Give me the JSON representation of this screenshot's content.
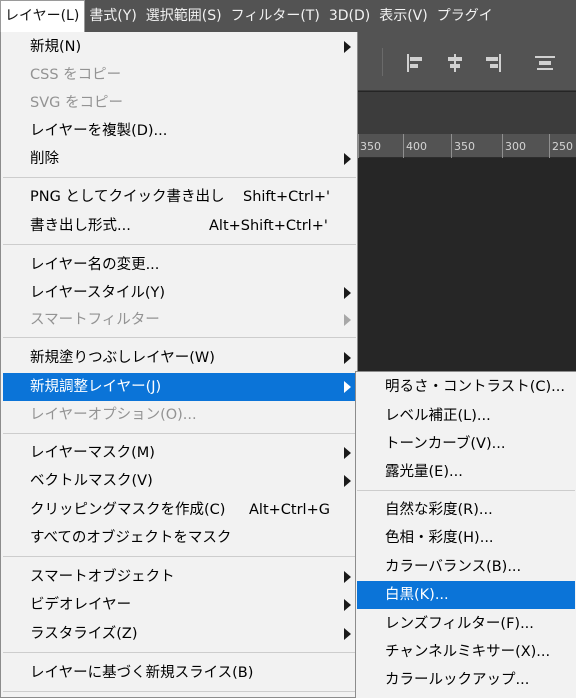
{
  "menubar": {
    "items": [
      {
        "label": "レイヤー(L)"
      },
      {
        "label": "書式(Y)"
      },
      {
        "label": "選択範囲(S)"
      },
      {
        "label": "フィルター(T)"
      },
      {
        "label": "3D(D)"
      },
      {
        "label": "表示(V)"
      },
      {
        "label": "プラグイ"
      }
    ]
  },
  "ruler": {
    "labels": [
      "350",
      "400",
      "350",
      "300",
      "250"
    ]
  },
  "layer_menu": {
    "items": [
      {
        "label": "新規(N)",
        "shortcut": "",
        "submenu": true,
        "disabled": false
      },
      {
        "label": "CSS をコピー",
        "shortcut": "",
        "submenu": false,
        "disabled": true
      },
      {
        "label": "SVG をコピー",
        "shortcut": "",
        "submenu": false,
        "disabled": true
      },
      {
        "label": "レイヤーを複製(D)...",
        "shortcut": "",
        "submenu": false,
        "disabled": false
      },
      {
        "label": "削除",
        "shortcut": "",
        "submenu": true,
        "disabled": false
      },
      {
        "label": "PNG としてクイック書き出し",
        "shortcut": "Shift+Ctrl+'",
        "submenu": false,
        "disabled": false
      },
      {
        "label": "書き出し形式...",
        "shortcut": "Alt+Shift+Ctrl+'",
        "submenu": false,
        "disabled": false
      },
      {
        "label": "レイヤー名の変更...",
        "shortcut": "",
        "submenu": false,
        "disabled": false
      },
      {
        "label": "レイヤースタイル(Y)",
        "shortcut": "",
        "submenu": true,
        "disabled": false
      },
      {
        "label": "スマートフィルター",
        "shortcut": "",
        "submenu": true,
        "disabled": true
      },
      {
        "label": "新規塗りつぶしレイヤー(W)",
        "shortcut": "",
        "submenu": true,
        "disabled": false
      },
      {
        "label": "新規調整レイヤー(J)",
        "shortcut": "",
        "submenu": true,
        "disabled": false,
        "highlighted": true
      },
      {
        "label": "レイヤーオプション(O)...",
        "shortcut": "",
        "submenu": false,
        "disabled": true
      },
      {
        "label": "レイヤーマスク(M)",
        "shortcut": "",
        "submenu": true,
        "disabled": false
      },
      {
        "label": "ベクトルマスク(V)",
        "shortcut": "",
        "submenu": true,
        "disabled": false
      },
      {
        "label": "クリッピングマスクを作成(C)",
        "shortcut": "Alt+Ctrl+G",
        "submenu": false,
        "disabled": false
      },
      {
        "label": "すべてのオブジェクトをマスク",
        "shortcut": "",
        "submenu": false,
        "disabled": false
      },
      {
        "label": "スマートオブジェクト",
        "shortcut": "",
        "submenu": true,
        "disabled": false
      },
      {
        "label": "ビデオレイヤー",
        "shortcut": "",
        "submenu": true,
        "disabled": false
      },
      {
        "label": "ラスタライズ(Z)",
        "shortcut": "",
        "submenu": true,
        "disabled": false
      },
      {
        "label": "レイヤーに基づく新規スライス(B)",
        "shortcut": "",
        "submenu": false,
        "disabled": false
      }
    ]
  },
  "adjustment_submenu": {
    "items": [
      {
        "label": "明るさ・コントラスト(C)..."
      },
      {
        "label": "レベル補正(L)..."
      },
      {
        "label": "トーンカーブ(V)..."
      },
      {
        "label": "露光量(E)..."
      },
      {
        "label": "自然な彩度(R)..."
      },
      {
        "label": "色相・彩度(H)..."
      },
      {
        "label": "カラーバランス(B)..."
      },
      {
        "label": "白黒(K)...",
        "highlighted": true
      },
      {
        "label": "レンズフィルター(F)..."
      },
      {
        "label": "チャンネルミキサー(X)..."
      },
      {
        "label": "カラールックアップ..."
      }
    ]
  },
  "colors": {
    "highlight": "#0b74d8",
    "menu_bg": "#f2f2f2",
    "menubar_bg": "#535353",
    "disabled_text": "#939393"
  }
}
